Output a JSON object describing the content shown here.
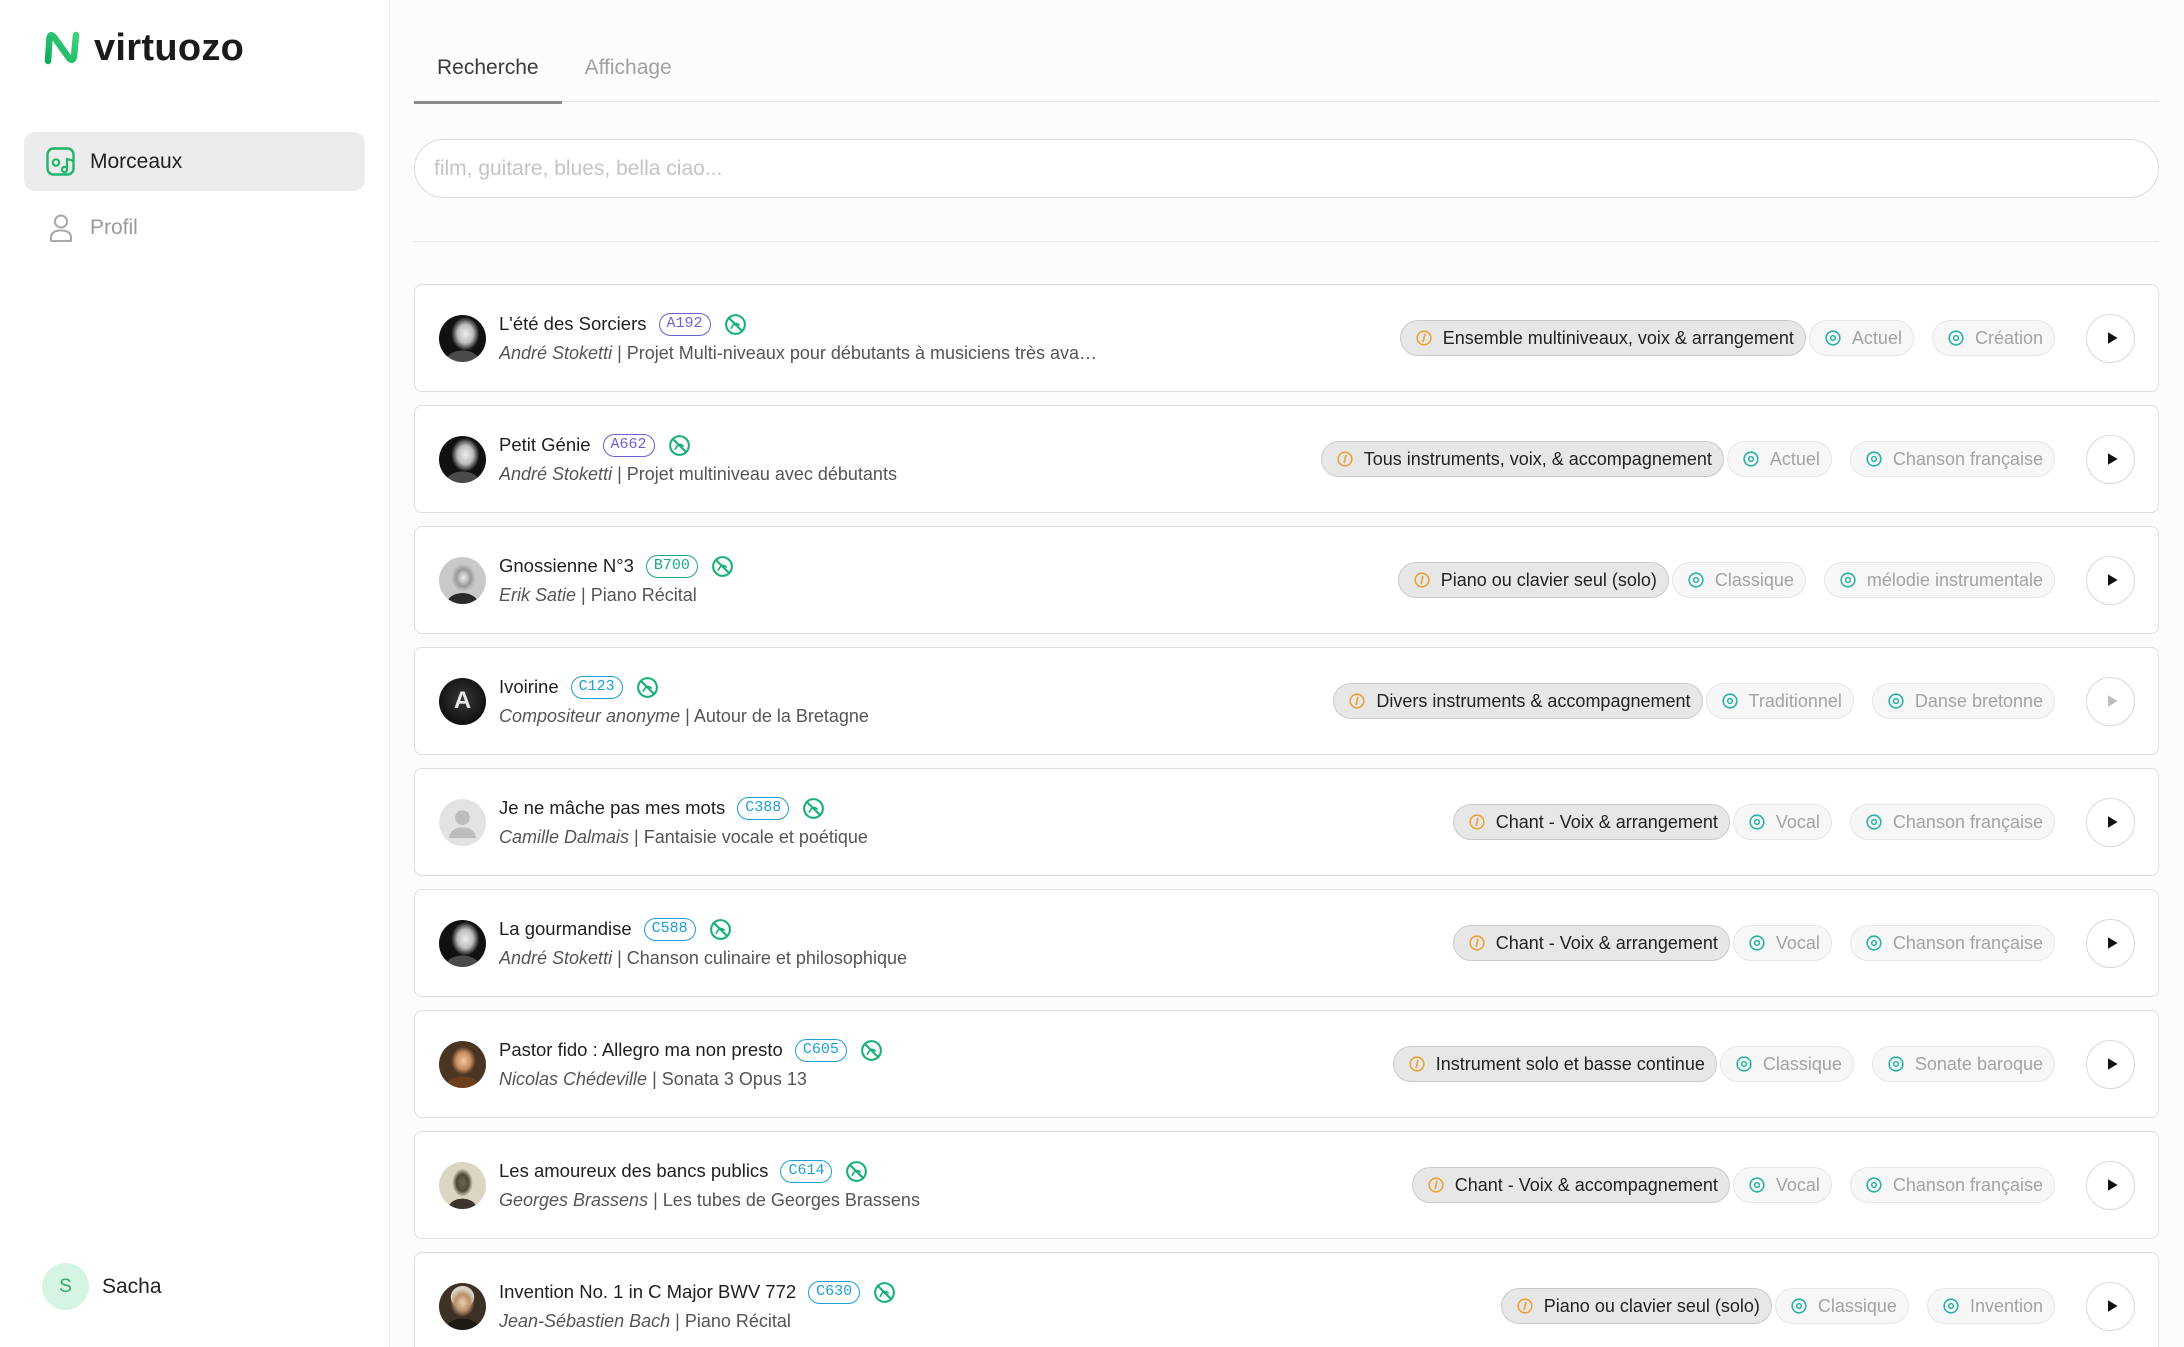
{
  "app": {
    "logo_text": "virtuozo",
    "logo_icon": "virtuozo-logo-icon"
  },
  "sidebar": {
    "nav": [
      {
        "label": "Morceaux",
        "icon": "music-library-icon",
        "active": true
      },
      {
        "label": "Profil",
        "icon": "user-icon",
        "active": false
      }
    ],
    "user": {
      "initial": "S",
      "name": "Sacha"
    }
  },
  "tabs": [
    {
      "label": "Recherche",
      "active": true
    },
    {
      "label": "Affichage",
      "active": false
    }
  ],
  "search": {
    "placeholder": "film, guitare, blues, bella ciao..."
  },
  "list": {
    "separator": "|"
  },
  "icons": {
    "status": "crossed-circle-icon",
    "instrumentation": "info-circle-icon",
    "style": "target-icon",
    "genre": "target-icon",
    "play": "play-icon"
  },
  "colors": {
    "brand": "#1dbb6b",
    "code_a": "#6a62d8",
    "code_b": "#1aa58e",
    "code_c": "#1c9ed6",
    "status_icon": "#17b075",
    "instrumentation_icon": "#eaa23a",
    "style_icon": "#2ab3a6"
  },
  "songs": [
    {
      "title": "L'été des Sorciers",
      "code": "A192",
      "composer": "André Stoketti",
      "description": "Projet Multi-niveaux pour débutants à musiciens très ava…",
      "instrumentation": "Ensemble multiniveaux, voix & arrangement",
      "style": "Actuel",
      "genre": "Création",
      "playable": true
    },
    {
      "title": "Petit Génie",
      "code": "A662",
      "composer": "André Stoketti",
      "description": "Projet multiniveau avec débutants",
      "instrumentation": "Tous instruments, voix, & accompagnement",
      "style": "Actuel",
      "genre": "Chanson française",
      "playable": true
    },
    {
      "title": "Gnossienne N°3",
      "code": "B700",
      "composer": "Erik Satie",
      "description": "Piano Récital",
      "instrumentation": "Piano ou clavier seul (solo)",
      "style": "Classique",
      "genre": "mélodie instrumentale",
      "playable": true
    },
    {
      "title": "Ivoirine",
      "code": "C123",
      "composer": "Compositeur anonyme",
      "description": "Autour de la Bretagne",
      "instrumentation": "Divers instruments & accompagnement",
      "style": "Traditionnel",
      "genre": "Danse bretonne",
      "playable": false,
      "avatar_letter": "A"
    },
    {
      "title": "Je ne mâche pas mes mots",
      "code": "C388",
      "composer": "Camille Dalmais",
      "description": "Fantaisie vocale et poétique",
      "instrumentation": "Chant - Voix & arrangement",
      "style": "Vocal",
      "genre": "Chanson française",
      "playable": true
    },
    {
      "title": "La gourmandise",
      "code": "C588",
      "composer": "André Stoketti",
      "description": "Chanson culinaire et philosophique",
      "instrumentation": "Chant - Voix & arrangement",
      "style": "Vocal",
      "genre": "Chanson française",
      "playable": true
    },
    {
      "title": "Pastor fido : Allegro ma non presto",
      "code": "C605",
      "composer": "Nicolas Chédeville",
      "description": "Sonata 3 Opus 13",
      "instrumentation": "Instrument solo et basse continue",
      "style": "Classique",
      "genre": "Sonate baroque",
      "playable": true
    },
    {
      "title": "Les amoureux des bancs publics",
      "code": "C614",
      "composer": "Georges Brassens",
      "description": "Les tubes de Georges Brassens",
      "instrumentation": "Chant - Voix & accompagnement",
      "style": "Vocal",
      "genre": "Chanson française",
      "playable": true
    },
    {
      "title": "Invention No. 1 in C Major BWV 772",
      "code": "C630",
      "composer": "Jean-Sébastien Bach",
      "description": "Piano Récital",
      "instrumentation": "Piano ou clavier seul (solo)",
      "style": "Classique",
      "genre": "Invention",
      "playable": true
    }
  ]
}
